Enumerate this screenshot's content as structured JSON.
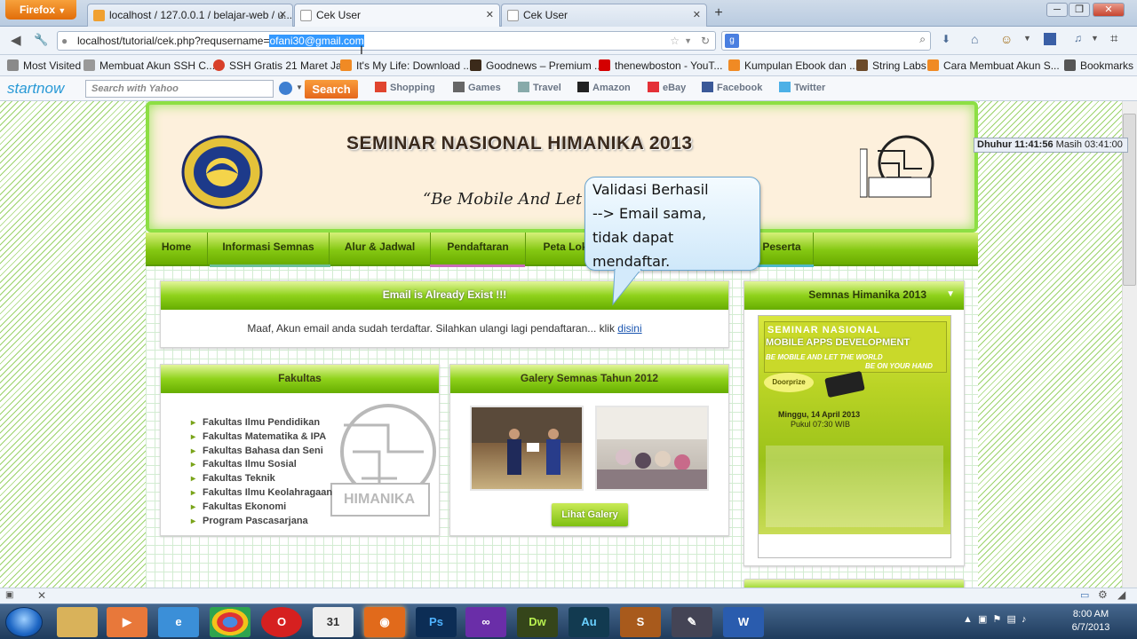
{
  "browser": {
    "app_button": "Firefox",
    "tabs": [
      {
        "label": "localhost / 127.0.0.1 / belajar-web / u..."
      },
      {
        "label": "Cek User"
      },
      {
        "label": "Cek User"
      }
    ],
    "new_tab": "+",
    "url_prefix": "localhost/tutorial/cek.php?requsername=",
    "url_selected": "ofani30@gmail.com",
    "bookmarks": [
      {
        "label": "Most Visited",
        "icon": "gear-icon"
      },
      {
        "label": "Membuat Akun SSH C...",
        "icon": "tools-icon"
      },
      {
        "label": "SSH Gratis 21 Maret Ja...",
        "icon": "blogger-icon"
      },
      {
        "label": "It's My Life: Download ...",
        "icon": "blogger-icon"
      },
      {
        "label": "Goodnews – Premium ...",
        "icon": "image-icon"
      },
      {
        "label": "thenewboston - YouT...",
        "icon": "youtube-icon"
      },
      {
        "label": "Kumpulan Ebook dan ...",
        "icon": "blogger-icon"
      },
      {
        "label": "String Labs",
        "icon": "image-icon"
      },
      {
        "label": "Cara Membuat Akun S...",
        "icon": "blogger-icon"
      }
    ],
    "bookmarks_menu": "Bookmarks",
    "toolbar": {
      "logo": "startnow",
      "search_placeholder": "Search with Yahoo",
      "search_button": "Search",
      "links": [
        "Shopping",
        "Games",
        "Travel",
        "Amazon",
        "eBay",
        "Facebook",
        "Twitter"
      ]
    }
  },
  "site": {
    "title": "SEMINAR NASIONAL HIMANIKA 2013",
    "tagline": "“Be Mobile And Let The W",
    "menu": [
      "Home",
      "Informasi Semnas",
      "Alur & Jadwal",
      "Pendaftaran",
      "Peta Lok",
      "Peserta"
    ],
    "alert": {
      "heading": "Email is Already Exist !!!",
      "message": "Maaf, Akun email anda sudah terdaftar. Silahkan ulangi lagi pendaftaran... klik ",
      "link": "disini"
    },
    "fakultas": {
      "heading": "Fakultas",
      "items": [
        "Fakultas Ilmu Pendidikan",
        "Fakultas Matematika & IPA",
        "Fakultas Bahasa dan Seni",
        "Fakultas Ilmu Sosial",
        "Fakultas Teknik",
        "Fakultas Ilmu Keolahragaan",
        "Fakultas Ekonomi",
        "Program Pascasarjana"
      ]
    },
    "gallery": {
      "heading": "Galery Semnas Tahun 2012",
      "button": "Lihat Galery"
    },
    "sidebar": {
      "heading": "Semnas Himanika 2013",
      "poster_lines": [
        "SEMINAR NASIONAL",
        "MOBILE APPS DEVELOPMENT",
        "BE MOBILE AND LET THE WORLD",
        "BE ON YOUR HAND",
        "Minggu, 14 April 2013",
        "Pukul 07:30 WIB"
      ]
    }
  },
  "callout": {
    "lines": [
      "Validasi Berhasil",
      "--> Email sama,",
      "tidak dapat",
      "mendaftar."
    ]
  },
  "clock_widget": {
    "label": "Dhuhur 11:41:56",
    "remaining": "Masih 03:41:00"
  },
  "taskbar": {
    "time": "8:00 AM",
    "date": "6/7/2013",
    "apps": [
      "explorer",
      "media",
      "ie",
      "chrome",
      "opera",
      "calendar",
      "firefox",
      "Ps",
      "VS",
      "Dw",
      "Au",
      "S",
      "pen",
      "W"
    ]
  },
  "colors": {
    "accent_green": "#85c812",
    "header_border": "#8ddf44",
    "link_blue": "#1a55b0"
  }
}
